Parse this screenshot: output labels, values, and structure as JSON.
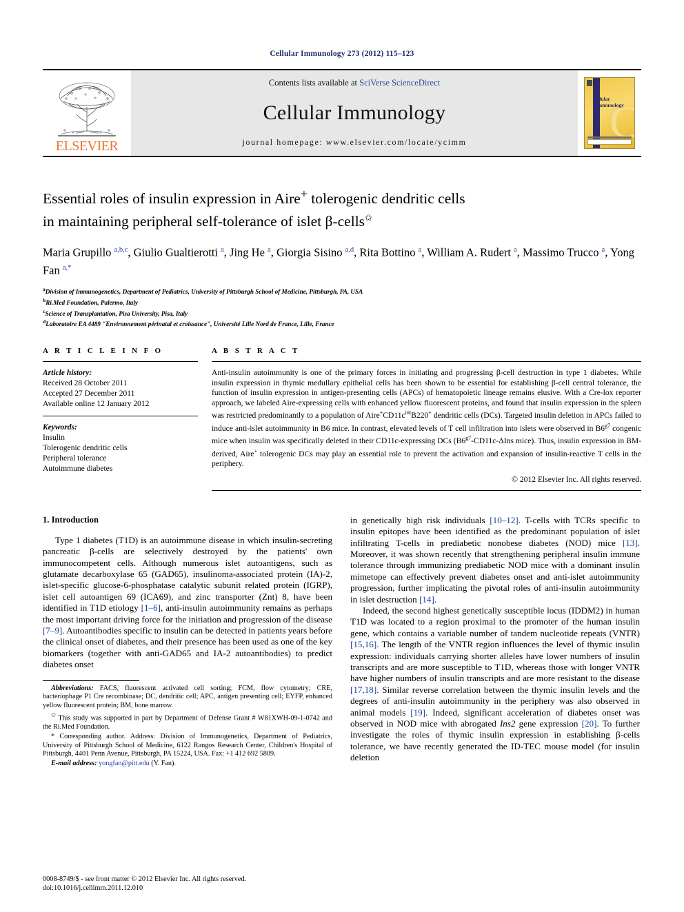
{
  "running_head": "Cellular Immunology 273 (2012) 115–123",
  "banner": {
    "publisher_name": "ELSEVIER",
    "contents_prefix": "Contents lists available at ",
    "contents_link": "SciVerse ScienceDirect",
    "journal_name": "Cellular Immunology",
    "homepage": "journal homepage: www.elsevier.com/locate/ycimm",
    "cover_title_line1": "ellular",
    "cover_title_line2": "Immunology"
  },
  "article": {
    "title_line1": "Essential roles of insulin expression in Aire",
    "title_sup1": "+",
    "title_line1b": " tolerogenic dendritic cells",
    "title_line2": "in maintaining peripheral self-tolerance of islet β-cells",
    "title_star": "✩",
    "authors_html": "Maria Grupillo <sup>a,b,c</sup>, Giulio Gualtierotti <sup>a</sup>, Jing He <sup>a</sup>, Giorgia Sisino <sup>a,d</sup>, Rita Bottino <sup>a</sup>, William A. Rudert <sup>a</sup>, Massimo Trucco <sup>a</sup>, Yong Fan <sup>a,</sup><sup>*</sup>",
    "affiliations": [
      {
        "marker": "a",
        "text": "Division of Immunogenetics, Department of Pediatrics, University of Pittsburgh School of Medicine, Pittsburgh, PA, USA"
      },
      {
        "marker": "b",
        "text": "Ri.Med Foundation, Palermo, Italy"
      },
      {
        "marker": "c",
        "text": "Science of Transplantation, Pisa University, Pisa, Italy"
      },
      {
        "marker": "d",
        "text": "Laboratoire EA 4489 \"Environnement périnatal et croissance\", Université Lille Nord de France, Lille, France"
      }
    ]
  },
  "article_info": {
    "heading": "A R T I C L E    I N F O",
    "history_label": "Article history:",
    "history": [
      "Received 28 October 2011",
      "Accepted 27 December 2011",
      "Available online 12 January 2012"
    ],
    "keywords_label": "Keywords:",
    "keywords": [
      "Insulin",
      "Tolerogenic dendritic cells",
      "Peripheral tolerance",
      "Autoimmune diabetes"
    ]
  },
  "abstract": {
    "heading": "A B S T R A C T",
    "text_html": "Anti-insulin autoimmunity is one of the primary forces in initiating and progressing β-cell destruction in type 1 diabetes. While insulin expression in thymic medullary epithelial cells has been shown to be essential for establishing β-cell central tolerance, the function of insulin expression in antigen-presenting cells (APCs) of hematopoietic lineage remains elusive. With a Cre-lox reporter approach, we labeled Aire-expressing cells with enhanced yellow fluorescent proteins, and found that insulin expression in the spleen was restricted predominantly to a population of Aire<sup>+</sup>CD11c<sup>int</sup>B220<sup>+</sup> dendritic cells (DCs). Targeted insulin deletion in APCs failed to induce anti-islet autoimmunity in B6 mice. In contrast, elevated levels of T cell infiltration into islets were observed in B6<sup>g7</sup> congenic mice when insulin was specifically deleted in their CD11c-expressing DCs (B6<sup>g7</sup>-CD11c-ΔIns mice). Thus, insulin expression in BM-derived, Aire<sup>+</sup> tolerogenic DCs may play an essential role to prevent the activation and expansion of insulin-reactive T cells in the periphery.",
    "copyright": "© 2012 Elsevier Inc. All rights reserved."
  },
  "body": {
    "section_heading": "1. Introduction",
    "left_paragraph_html": "Type 1 diabetes (T1D) is an autoimmune disease in which insulin-secreting pancreatic β-cells are selectively destroyed by the patients' own immunocompetent cells. Although numerous islet autoantigens, such as glutamate decarboxylase 65 (GAD65), insulinoma-associated protein (IA)-2, islet-specific glucose-6-phosphatase catalytic subunit related protein (IGRP), islet cell autoantigen 69 (ICA69), and zinc transporter (Znt) 8, have been identified in T1D etiology <span class=\"ref\">[1–6]</span>, anti-insulin autoimmunity remains as perhaps the most important driving force for the initiation and progression of the disease <span class=\"ref\">[7–9]</span>. Autoantibodies specific to insulin can be detected in patients years before the clinical onset of diabetes, and their presence has been used as one of the key biomarkers (together with anti-GAD65 and IA-2 autoantibodies) to predict diabetes onset",
    "right_paragraph1_html": "in genetically high risk individuals <span class=\"ref\">[10–12]</span>. T-cells with TCRs specific to insulin epitopes have been identified as the predominant population of islet infiltrating T-cells in prediabetic nonobese diabetes (NOD) mice <span class=\"ref\">[13]</span>. Moreover, it was shown recently that strengthening peripheral insulin immune tolerance through immunizing prediabetic NOD mice with a dominant insulin mimetope can effectively prevent diabetes onset and anti-islet autoimmunity progression, further implicating the pivotal roles of anti-insulin autoimmunity in islet destruction <span class=\"ref\">[14]</span>.",
    "right_paragraph2_html": "Indeed, the second highest genetically susceptible locus (IDDM2) in human T1D was located to a region proximal to the promoter of the human insulin gene, which contains a variable number of tandem nucleotide repeats (VNTR) <span class=\"ref\">[15,16]</span>. The length of the VNTR region influences the level of thymic insulin expression: individuals carrying shorter alleles have lower numbers of insulin transcripts and are more susceptible to T1D, whereas those with longer VNTR have higher numbers of insulin transcripts and are more resistant to the disease <span class=\"ref\">[17,18]</span>. Similar reverse correlation between the thymic insulin levels and the degrees of anti-insulin autoimmunity in the periphery was also observed in animal models <span class=\"ref\">[19]</span>. Indeed, significant acceleration of diabetes onset was observed in NOD mice with abrogated <span class=\"ital\">Ins2</span> gene expression <span class=\"ref\">[20]</span>. To further investigate the roles of thymic insulin expression in establishing β-cells tolerance, we have recently generated the ID-TEC mouse model (for insulin deletion"
  },
  "footnotes": {
    "abbreviations_html": "<span class=\"ital\">Abbreviations:</span> FACS, fluorescent activated cell sorting; FCM, flow cytometry; CRE, bacteriophage P1 Cre recombinase; DC, dendritic cell; APC, antigen presenting cell; EYFP, enhanced yellow fluorescent protein; BM, bone marrow.",
    "grant_html": "<sup>✩</sup> This study was supported in part by Department of Defense Grant # W81XWH-09-1-0742 and the Ri.Med Foundation.",
    "corresponding_html": "* Corresponding author. Address: Division of Immunogenetics, Department of Pediatrics, University of Pittsburgh School of Medicine, 6122 Rangos Research Center, Children's Hospital of Pittsburgh, 4401 Penn Avenue, Pittsburgh, PA 15224, USA. Fax: +1 412 692 5809.",
    "email_html": "<span class=\"ital\">E-mail address:</span> <span class=\"mail\">yongfan@pitt.edu</span> (Y. Fan)."
  },
  "footer": {
    "line1": "0008-8749/$ - see front matter © 2012 Elsevier Inc. All rights reserved.",
    "line2": "doi:10.1016/j.cellimm.2011.12.010"
  },
  "colors": {
    "runhead": "#1b2a6b",
    "link": "#2b4c9b",
    "reference": "#1b3fa0",
    "elsevier_orange": "#E8762A",
    "banner_grey": "#e7e7e7"
  }
}
